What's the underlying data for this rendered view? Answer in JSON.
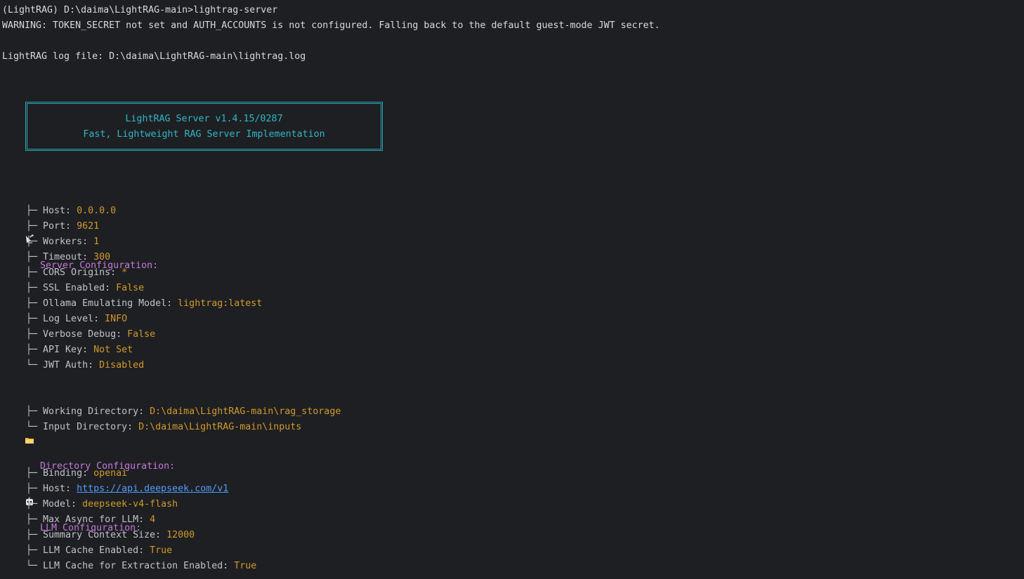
{
  "prompt": "(LightRAG) D:\\daima\\LightRAG-main>lightrag-server",
  "warning": "WARNING: TOKEN_SECRET not set and AUTH_ACCOUNTS is not configured. Falling back to the default guest-mode JWT secret.",
  "logfile": "LightRAG log file: D:\\daima\\LightRAG-main\\lightrag.log",
  "banner": {
    "title": "LightRAG Server v1.4.15/0287",
    "subtitle": "Fast, Lightweight RAG Server Implementation"
  },
  "colors": {
    "background": "#1e1f22",
    "section": "#c678dd",
    "value": "#d19a2b",
    "banner": "#2fb7c7",
    "link": "#4f9cff"
  },
  "sections": {
    "server": {
      "icon": "satellite-dish-icon",
      "title": "Server Configuration:",
      "items": [
        {
          "branch": "├─",
          "label": "Host:",
          "value": "0.0.0.0"
        },
        {
          "branch": "├─",
          "label": "Port:",
          "value": "9621"
        },
        {
          "branch": "├─",
          "label": "Workers:",
          "value": "1"
        },
        {
          "branch": "├─",
          "label": "Timeout:",
          "value": "300"
        },
        {
          "branch": "├─",
          "label": "CORS Origins:",
          "value": "*"
        },
        {
          "branch": "├─",
          "label": "SSL Enabled:",
          "value": "False"
        },
        {
          "branch": "├─",
          "label": "Ollama Emulating Model:",
          "value": "lightrag:latest"
        },
        {
          "branch": "├─",
          "label": "Log Level:",
          "value": "INFO"
        },
        {
          "branch": "├─",
          "label": "Verbose Debug:",
          "value": "False"
        },
        {
          "branch": "├─",
          "label": "API Key:",
          "value": "Not Set"
        },
        {
          "branch": "└─",
          "label": "JWT Auth:",
          "value": "Disabled"
        }
      ]
    },
    "directory": {
      "icon": "folder-icon",
      "title": "Directory Configuration:",
      "items": [
        {
          "branch": "├─",
          "label": "Working Directory:",
          "value": "D:\\daima\\LightRAG-main\\rag_storage"
        },
        {
          "branch": "└─",
          "label": "Input Directory:",
          "value": "D:\\daima\\LightRAG-main\\inputs"
        }
      ]
    },
    "llm": {
      "icon": "robot-icon",
      "title": "LLM Configuration:",
      "items": [
        {
          "branch": "├─",
          "label": "Binding:",
          "value": "openai"
        },
        {
          "branch": "├─",
          "label": "Host:",
          "value": "https://api.deepseek.com/v1",
          "link": true
        },
        {
          "branch": "├─",
          "label": "Model:",
          "value": "deepseek-v4-flash"
        },
        {
          "branch": "├─",
          "label": "Max Async for LLM:",
          "value": "4"
        },
        {
          "branch": "├─",
          "label": "Summary Context Size:",
          "value": "12000"
        },
        {
          "branch": "├─",
          "label": "LLM Cache Enabled:",
          "value": "True"
        },
        {
          "branch": "└─",
          "label": "LLM Cache for Extraction Enabled:",
          "value": "True"
        }
      ]
    }
  }
}
